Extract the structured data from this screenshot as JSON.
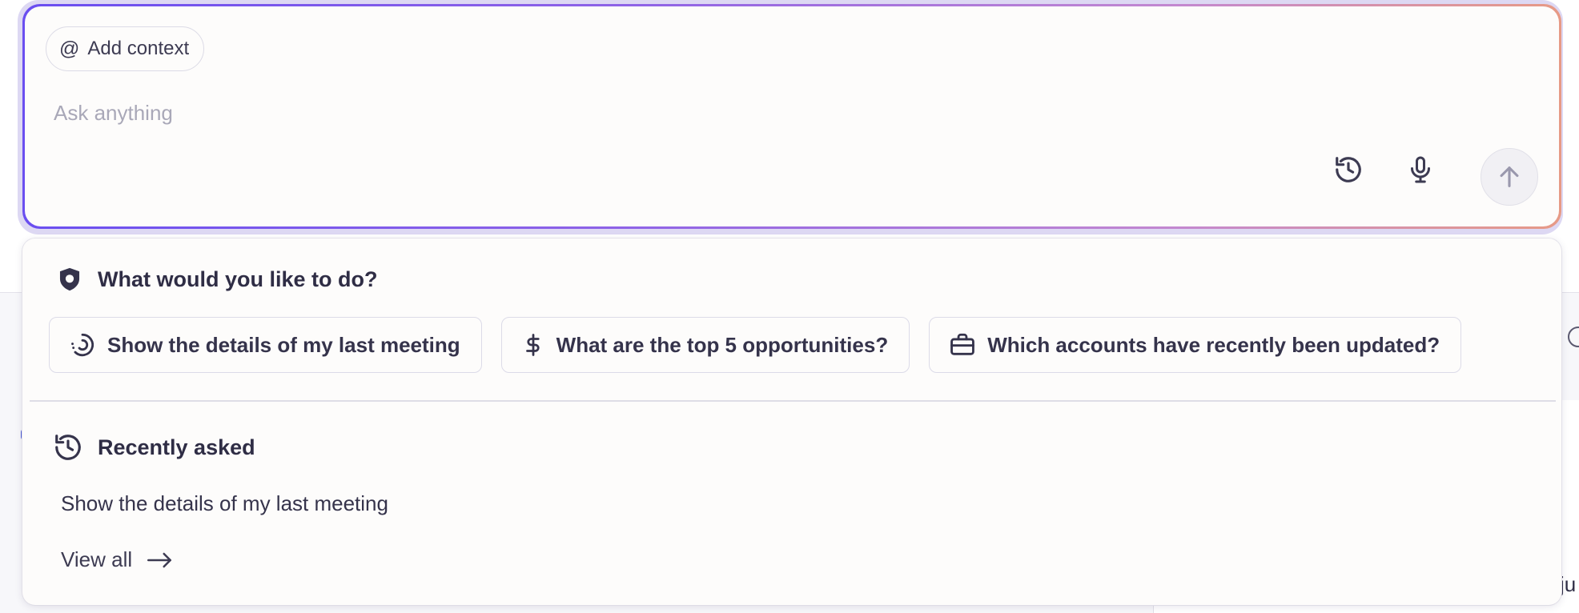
{
  "prompt": {
    "add_context_icon": "@",
    "add_context_label": "Add context",
    "placeholder": "Ask anything",
    "value": "",
    "actions": {
      "history_icon": "history-icon",
      "mic_icon": "microphone-icon",
      "send_icon": "arrow-up-icon"
    }
  },
  "suggestions": {
    "heading": "What would you like to do?",
    "heading_icon": "shield-icon",
    "items": [
      {
        "label": "Show the details of my last meeting",
        "icon": "spinner-icon"
      },
      {
        "label": "What are the top 5 opportunities?",
        "icon": "dollar-icon"
      },
      {
        "label": "Which accounts have recently been updated?",
        "icon": "briefcase-icon"
      }
    ]
  },
  "recent": {
    "heading": "Recently asked",
    "heading_icon": "history-icon",
    "items": [
      {
        "label": "Show the details of my last meeting"
      }
    ],
    "view_all_label": "View all",
    "view_all_icon": "arrow-right-icon"
  },
  "background": {
    "partial_text": "ju"
  },
  "colors": {
    "accent_start": "#6a4ef0",
    "accent_end": "#e79a86",
    "text": "#2f2d45",
    "placeholder": "#a9a8b8"
  }
}
